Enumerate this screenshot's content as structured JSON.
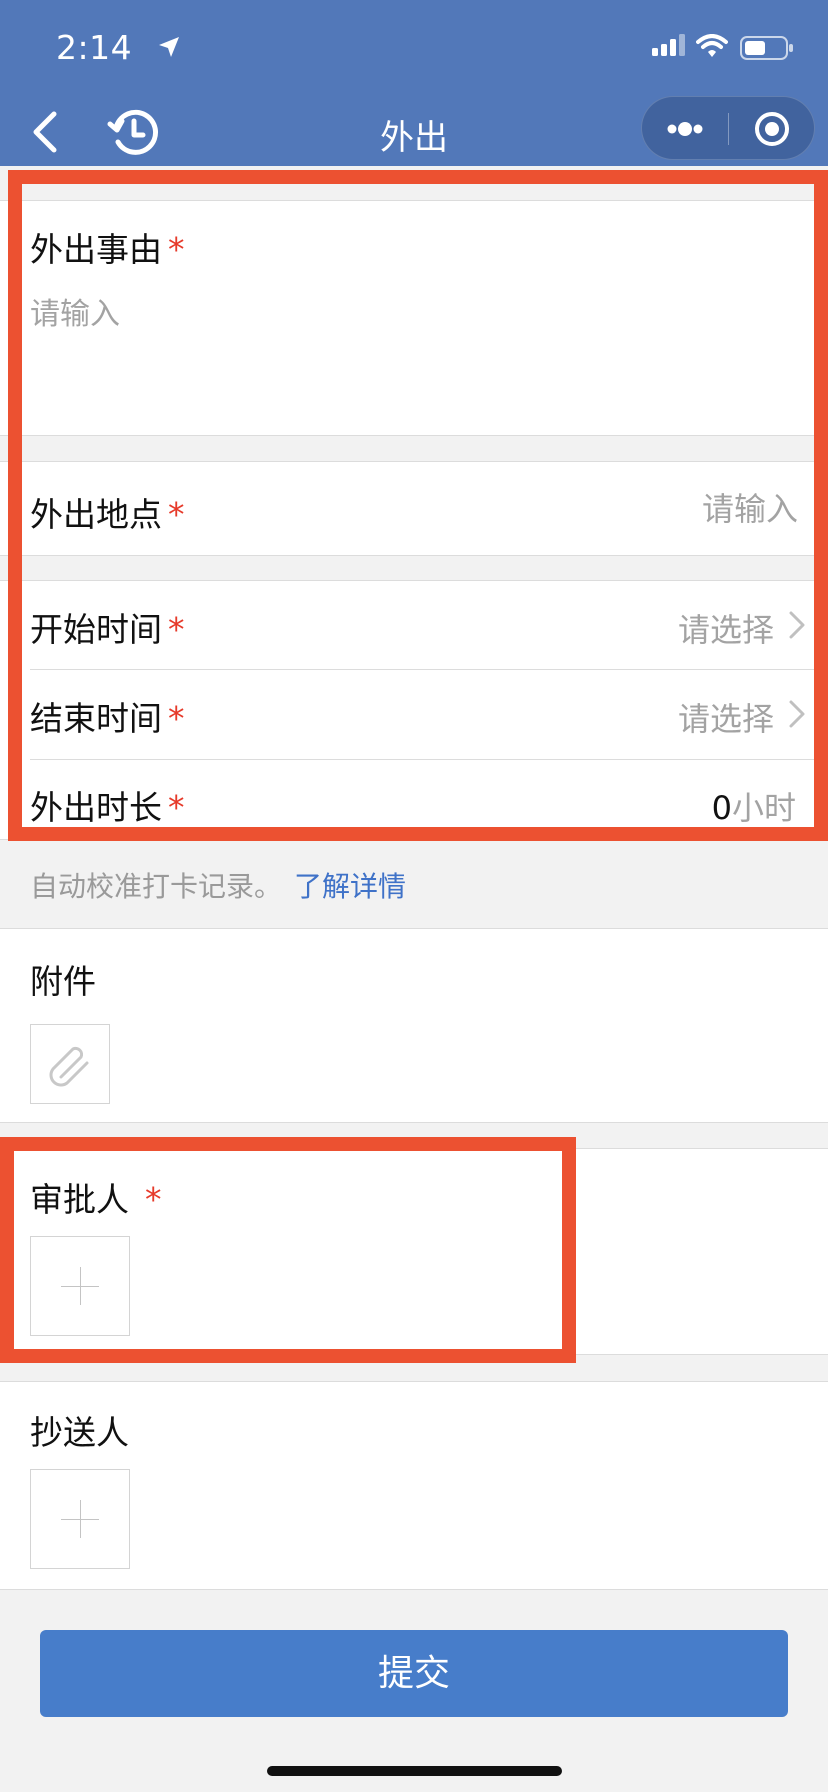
{
  "status_bar": {
    "time": "2:14",
    "icons": [
      "location-arrow-icon",
      "signal-icon",
      "wifi-icon",
      "battery-icon"
    ]
  },
  "nav": {
    "title": "外出",
    "icons": [
      "back-icon",
      "history-icon",
      "more-icon",
      "close-circle-icon"
    ]
  },
  "form": {
    "reason": {
      "label": "外出事由",
      "required_mark": "*",
      "placeholder": "请输入",
      "value": ""
    },
    "place": {
      "label": "外出地点",
      "required_mark": "*",
      "placeholder": "请输入",
      "value": ""
    },
    "start_time": {
      "label": "开始时间",
      "required_mark": "*",
      "value": "请选择"
    },
    "end_time": {
      "label": "结束时间",
      "required_mark": "*",
      "value": "请选择"
    },
    "duration": {
      "label": "外出时长",
      "required_mark": "*",
      "value": "0",
      "unit": "小时"
    }
  },
  "hint": {
    "text": "自动校准打卡记录。",
    "link": "了解详情"
  },
  "attachment": {
    "label": "附件",
    "icon": "paperclip-icon"
  },
  "approver": {
    "label": "审批人",
    "required_mark": "*"
  },
  "cc": {
    "label": "抄送人"
  },
  "submit": {
    "label": "提交"
  },
  "colors": {
    "header_bg": "#5278b9",
    "submit_bg": "#477dca",
    "required": "#e63a2a",
    "link": "#3f72c8",
    "highlight_border": "#ec5131"
  }
}
